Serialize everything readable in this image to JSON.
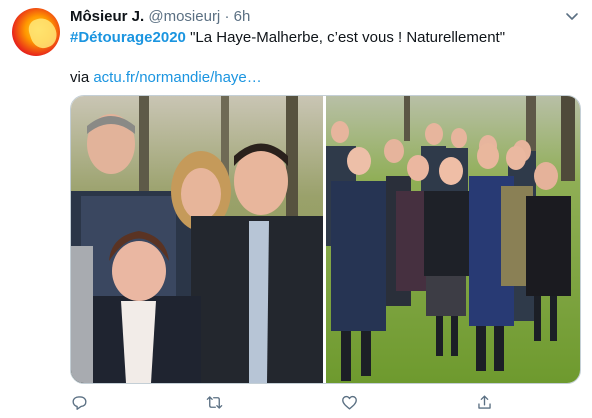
{
  "tweet": {
    "author_name": "Môsieur J.",
    "handle": "@mosieurj",
    "separator": "·",
    "time": "6h",
    "hashtag": "#Détourage2020",
    "text": " \"La Haye-Malherbe, c’est vous ! Naturellement\"",
    "via_label": "via ",
    "link": "actu.fr/normandie/haye…"
  },
  "media": {
    "left_photo": "cropped group photo close-up",
    "right_photo": "group photo outdoors"
  },
  "actions": {
    "reply_icon": "reply-icon",
    "retweet_icon": "retweet-icon",
    "like_icon": "like-icon",
    "share_icon": "share-icon"
  },
  "colors": {
    "accent": "#1b95e0",
    "secondary_text": "#5b7083",
    "border": "#c4cfd6"
  }
}
